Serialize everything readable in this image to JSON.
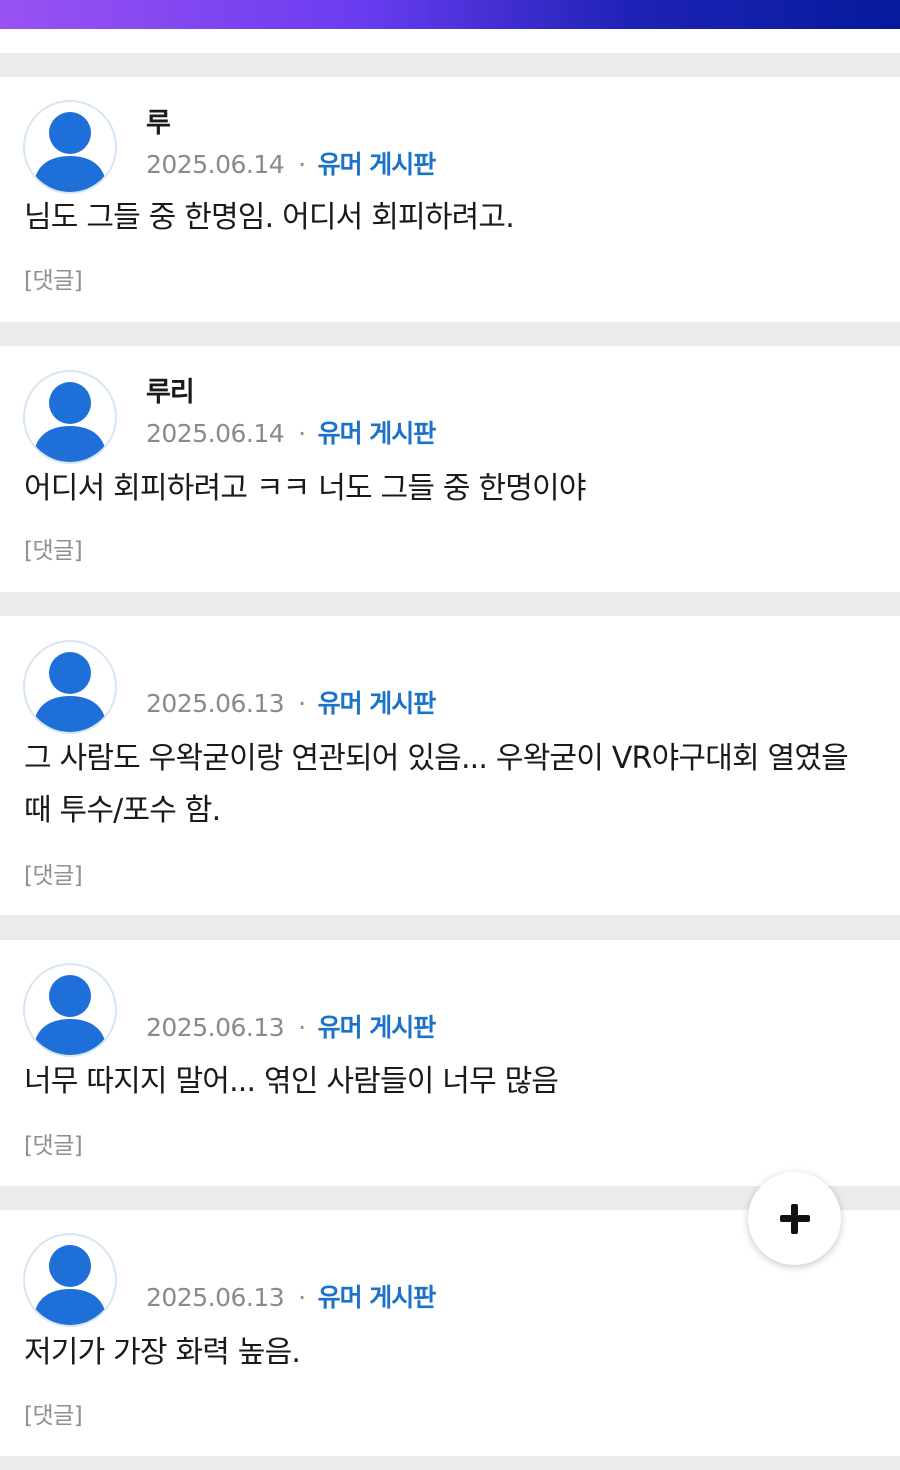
{
  "colors": {
    "board_link": "#1a73c8",
    "avatar": "#1f6fd8",
    "separator": "#ebebeb"
  },
  "comments": [
    {
      "author": "루",
      "date": "2025.06.14",
      "board": "유머 게시판",
      "text": "님도 그들 중 한명임. 어디서 회피하려고.",
      "reply_label": "[댓글]"
    },
    {
      "author": "루리",
      "date": "2025.06.14",
      "board": "유머 게시판",
      "text": "어디서 회피하려고 ㅋㅋ 너도 그들 중 한명이야",
      "reply_label": "[댓글]"
    },
    {
      "author": "",
      "date": "2025.06.13",
      "board": "유머 게시판",
      "text": "그 사람도 우왁굳이랑 연관되어 있음... 우왁굳이 VR야구대회 열였을 때 투수/포수 함.",
      "reply_label": "[댓글]"
    },
    {
      "author": "",
      "date": "2025.06.13",
      "board": "유머 게시판",
      "text": "너무 따지지 말어... 엮인 사람들이 너무 많음",
      "reply_label": "[댓글]"
    },
    {
      "author": "",
      "date": "2025.06.13",
      "board": "유머 게시판",
      "text": "저기가 가장 화력 높음.",
      "reply_label": "[댓글]"
    }
  ],
  "fab": {
    "icon": "plus-icon"
  }
}
